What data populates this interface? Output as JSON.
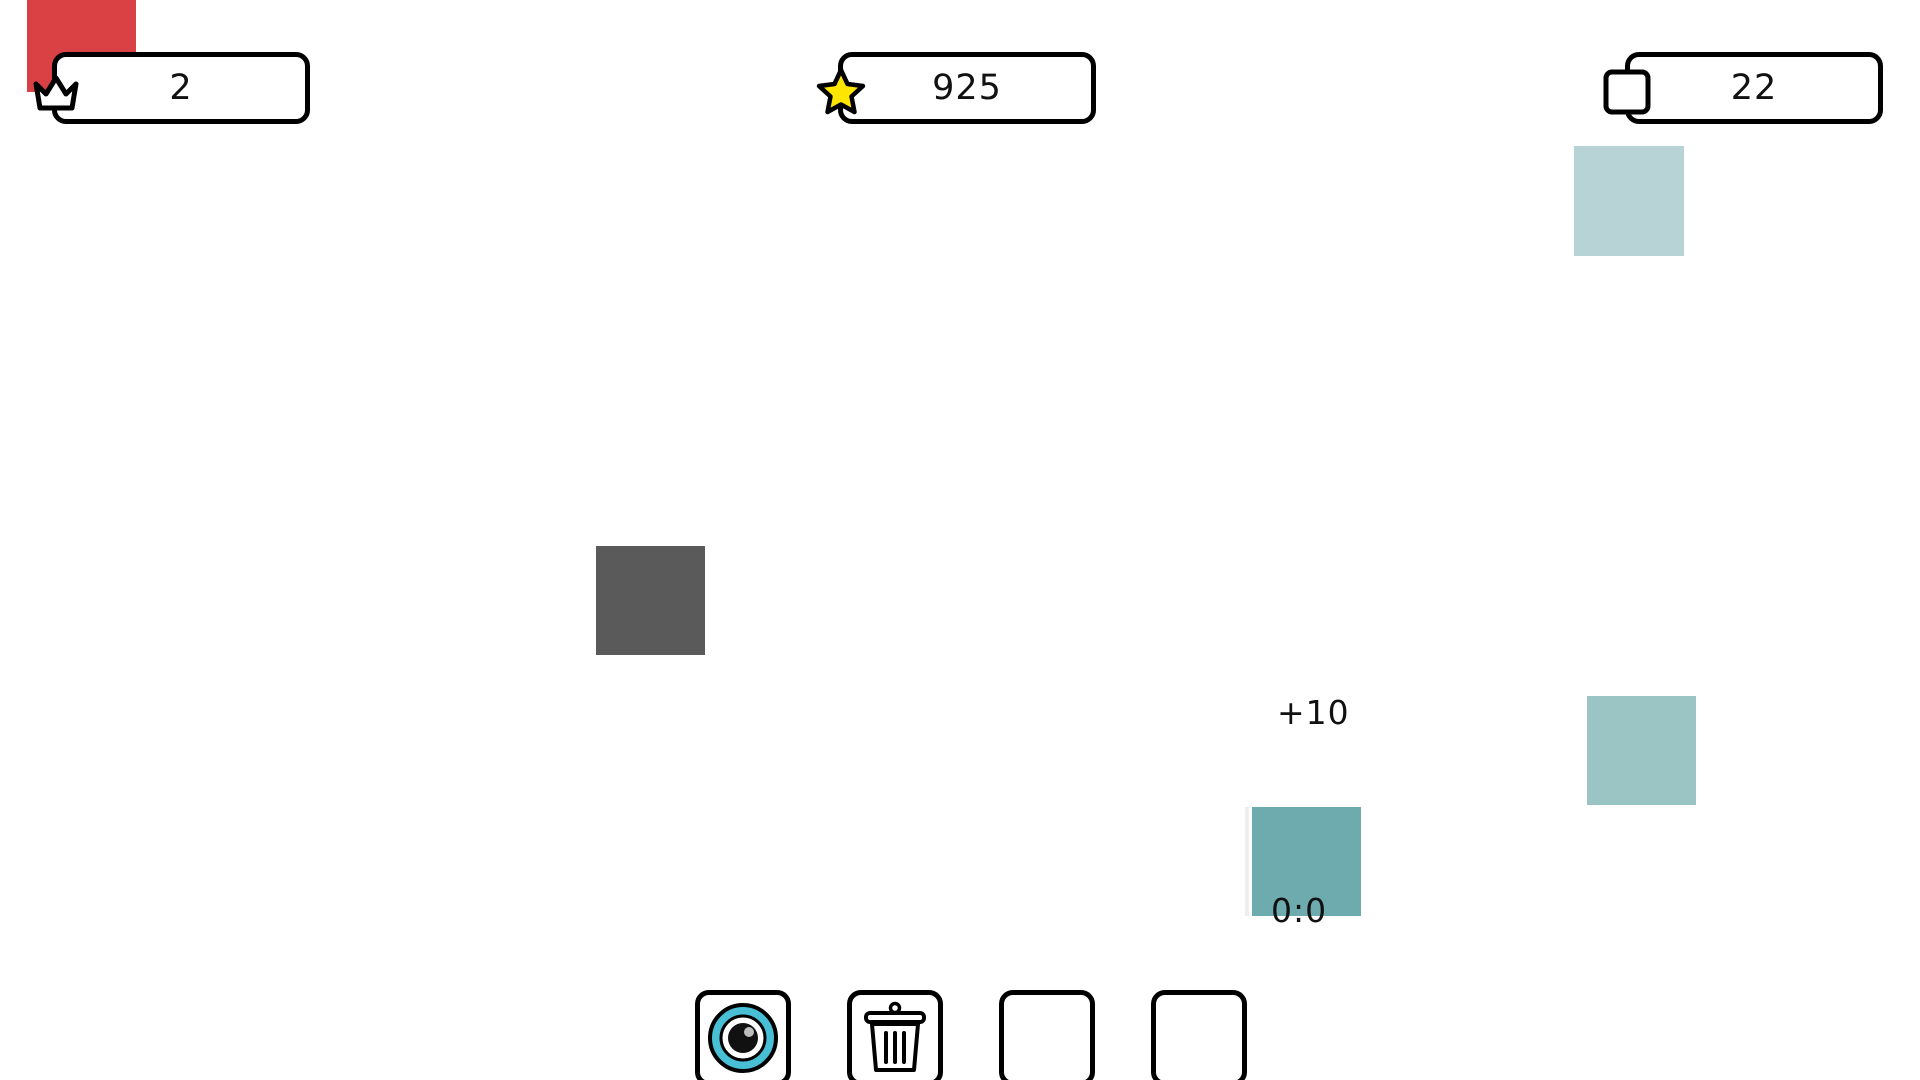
{
  "hud": {
    "level": "2",
    "score": "925",
    "blocks": "22"
  },
  "field": {
    "float_bonus": "+10",
    "timer": "0:0"
  },
  "colors": {
    "corner_tile": "#d94144",
    "pale_tile": "#b7d3d5",
    "dark_tile": "#5a5a5a",
    "mid_tile": "#9bc4c5",
    "teal_tile": "#6eabae",
    "star": "#ffe600",
    "eye": "#48bfd4"
  },
  "icons": {
    "level": "crown-icon",
    "score": "star-icon",
    "blocks": "square-icon",
    "tool_1": "eye-icon",
    "tool_2": "trash-icon",
    "tool_3": "empty-slot",
    "tool_4": "empty-slot"
  }
}
